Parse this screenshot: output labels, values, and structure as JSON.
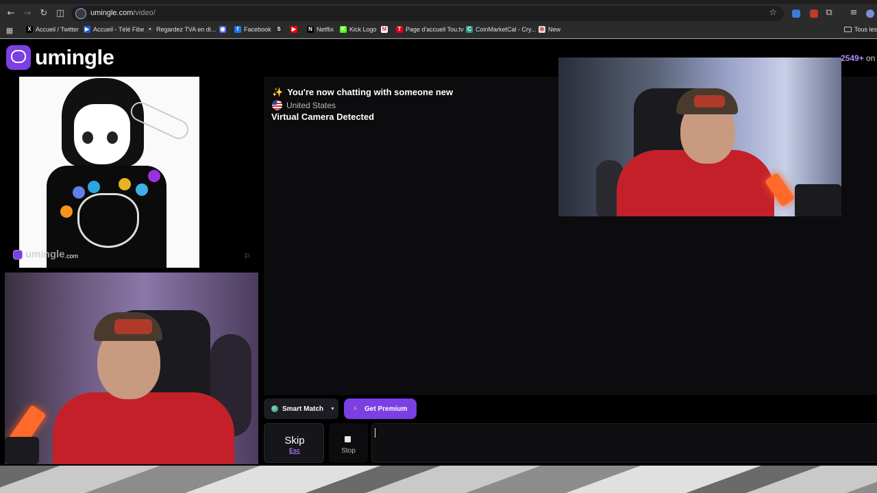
{
  "browser": {
    "url_host": "umingle.com",
    "url_path": "/video/",
    "bookmarks": [
      {
        "label": "Accueil / Twitter",
        "color": "#000000",
        "glyph": "X"
      },
      {
        "label": "Accueil - Télé Fibe",
        "color": "#1f5fd6",
        "glyph": "▶"
      },
      {
        "label": "Regardez TVA en di...",
        "color": "#333333",
        "glyph": "•"
      },
      {
        "label": "",
        "color": "#5865f2",
        "glyph": "◉"
      },
      {
        "label": "Facebook",
        "color": "#1877f2",
        "glyph": "f"
      },
      {
        "label": "",
        "color": "#222222",
        "glyph": "S"
      },
      {
        "label": "",
        "color": "#ff0000",
        "glyph": "▶"
      },
      {
        "label": "Netflix",
        "color": "#000000",
        "glyph": "N"
      },
      {
        "label": "Kick Logo",
        "color": "#53fc18",
        "glyph": "K"
      },
      {
        "label": "",
        "color": "#ffffff",
        "glyph": "M"
      },
      {
        "label": "Page d'accueil Tou.tv",
        "color": "#e3001b",
        "glyph": "T"
      },
      {
        "label": "CoinMarketCal - Cry...",
        "color": "#2a9a8a",
        "glyph": "C"
      },
      {
        "label": "New",
        "color": "#dddddd",
        "glyph": "⊕"
      }
    ],
    "bookmarks_all": "Tous les"
  },
  "brand": {
    "name": "umingle"
  },
  "watermark": {
    "name": "umingle",
    "suffix": ".com"
  },
  "chat": {
    "new_chat": "You're now chatting with someone new",
    "spark": "✨",
    "country": "United States",
    "notice": "Virtual Camera Detected"
  },
  "online": {
    "count": "2549+",
    "rest": " on"
  },
  "controls": {
    "smart_match": "Smart Match",
    "get_premium": "Get Premium",
    "skip": "Skip",
    "skip_key": "Esc",
    "stop": "Stop",
    "message_value": ""
  }
}
